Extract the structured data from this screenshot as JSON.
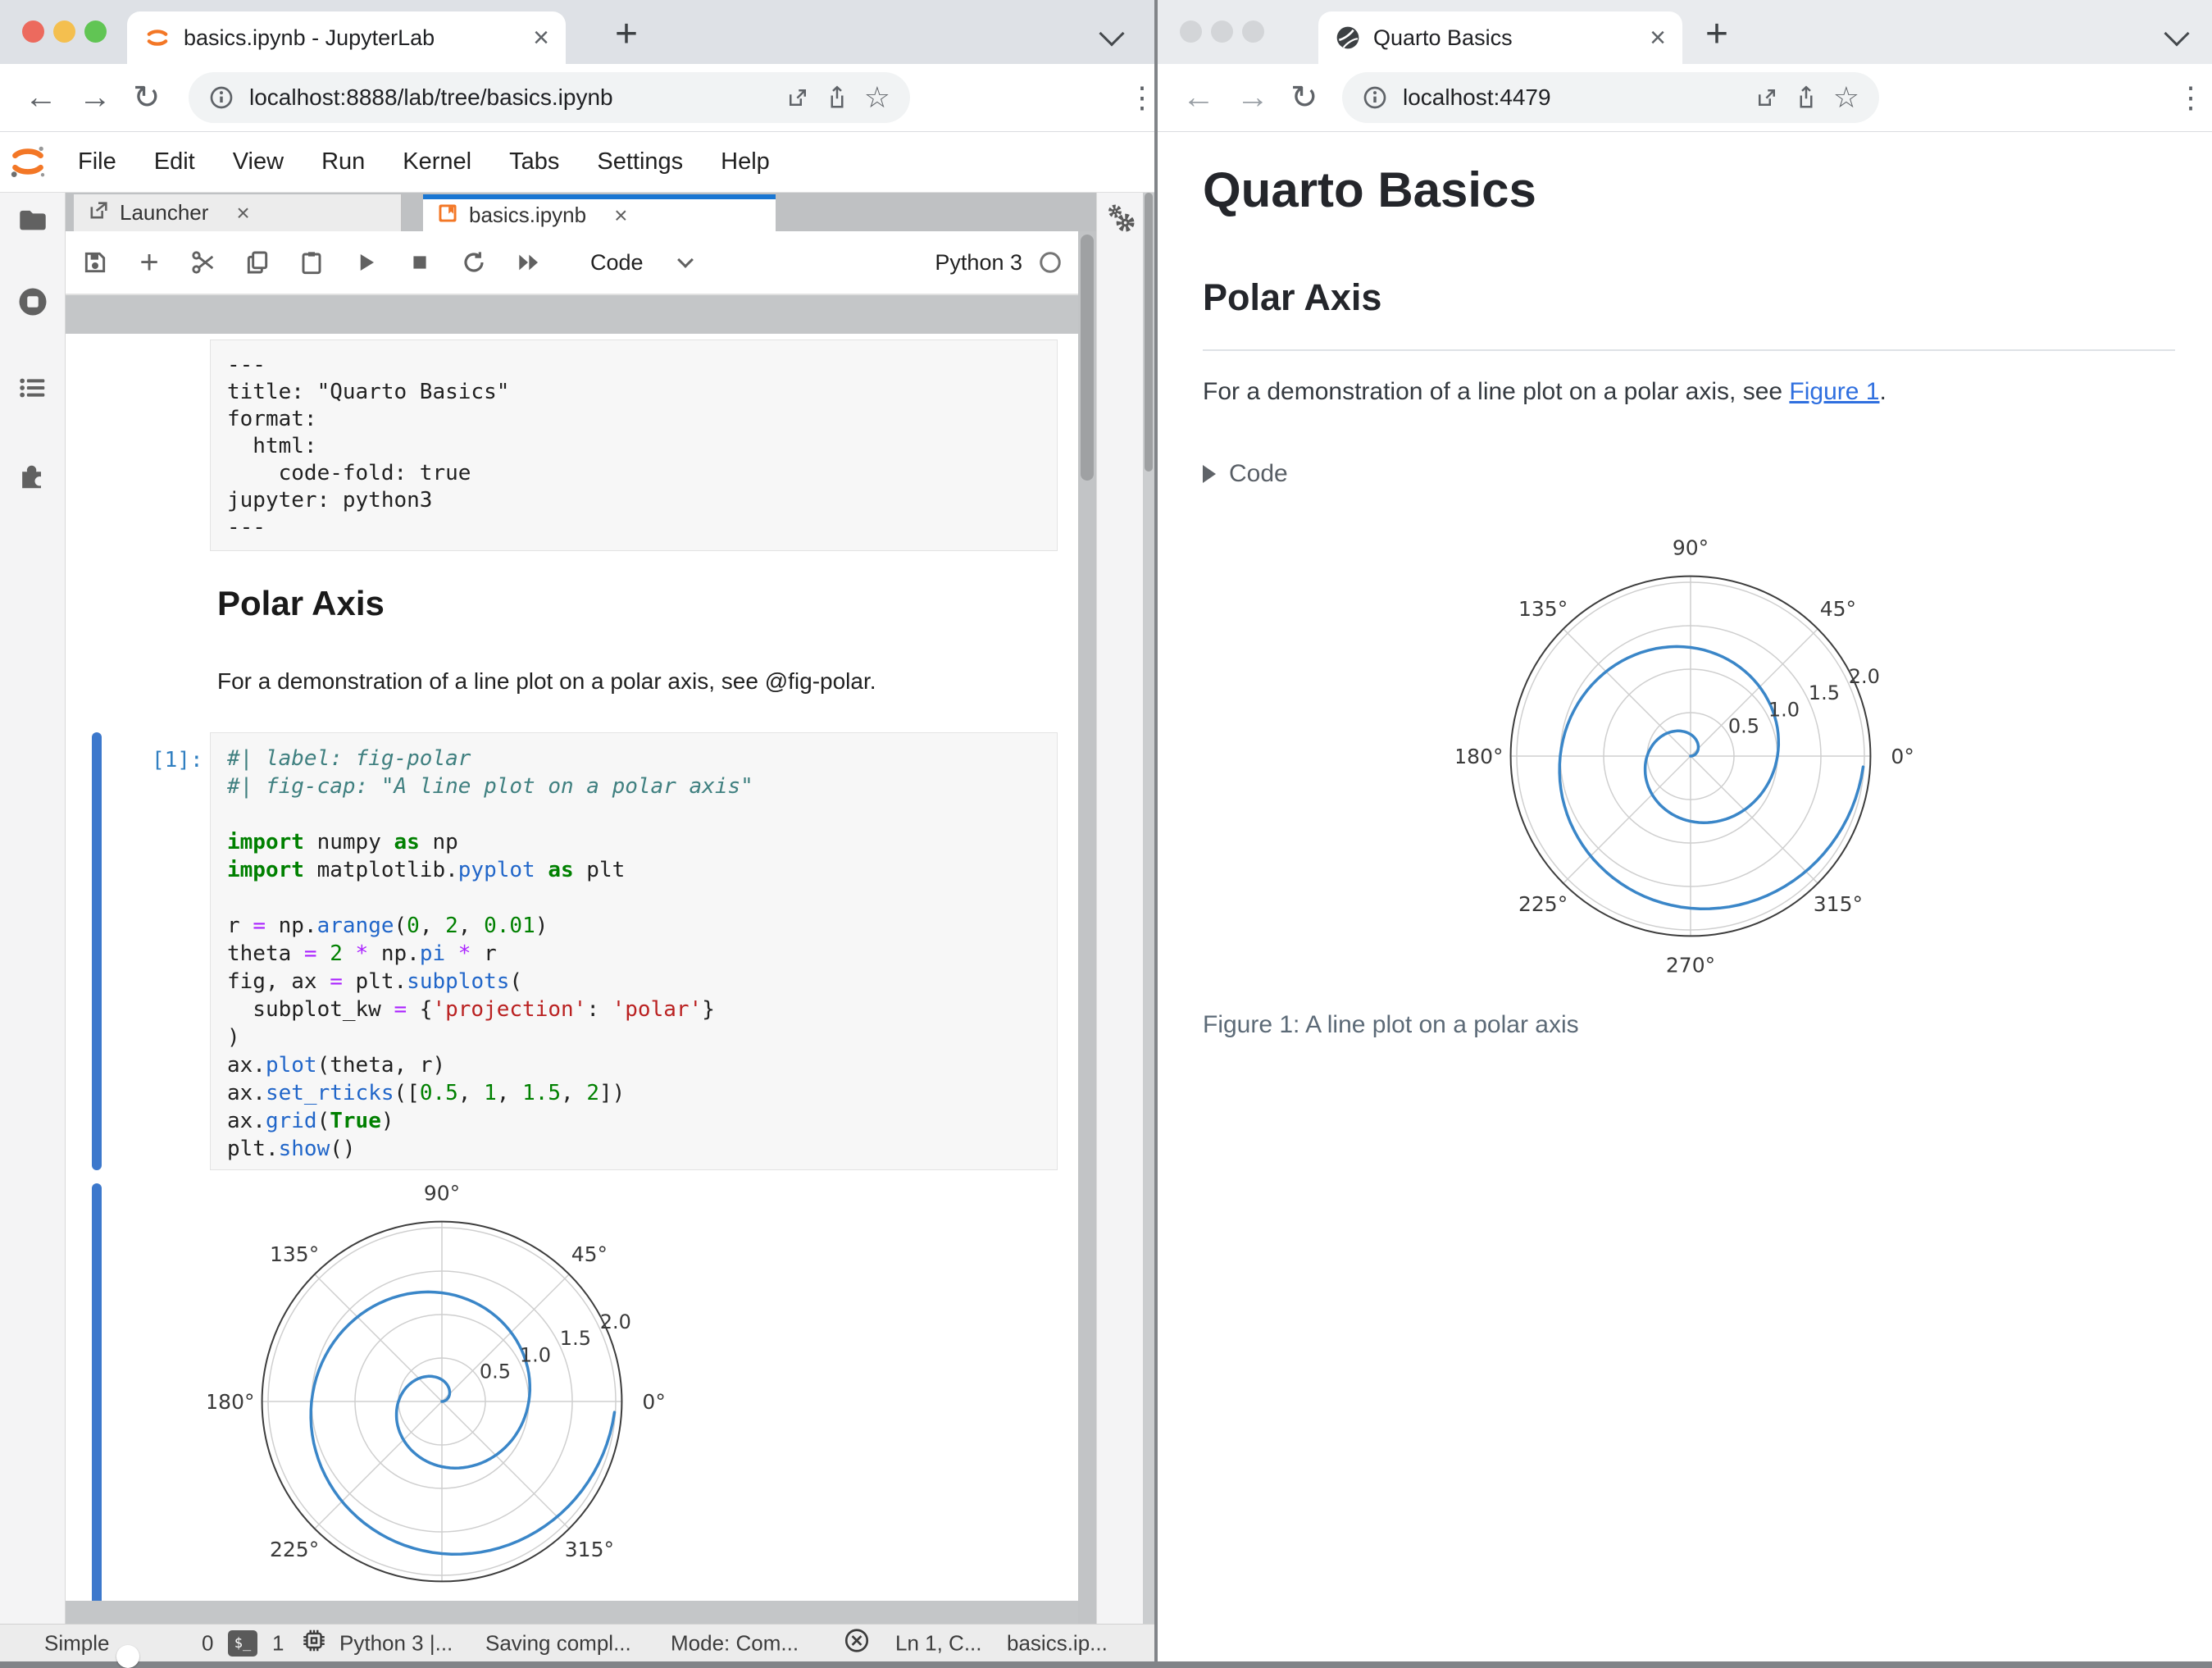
{
  "colors": {
    "jl_accent": "#1976d2",
    "jl_collapser": "#3c78cc",
    "jupyter_orange": "#f37726",
    "link_blue": "#2f6fdf",
    "plot_line_blue": "#3a86c8"
  },
  "chrome_left": {
    "tab_title": "basics.ipynb - JupyterLab",
    "url": "localhost:8888/lab/tree/basics.ipynb"
  },
  "chrome_right": {
    "tab_title": "Quarto Basics",
    "url": "localhost:4479"
  },
  "jupyterlab": {
    "menu": [
      "File",
      "Edit",
      "View",
      "Run",
      "Kernel",
      "Tabs",
      "Settings",
      "Help"
    ],
    "dock_tabs": {
      "launcher": "Launcher",
      "notebook": "basics.ipynb"
    },
    "toolbar": {
      "cell_type": "Code",
      "kernel_name": "Python 3"
    },
    "notebook": {
      "yaml_lines": [
        "---",
        "title: \"Quarto Basics\"",
        "format:",
        "  html:",
        "    code-fold: true",
        "jupyter: python3",
        "---"
      ],
      "md_heading": "Polar Axis",
      "md_paragraph": "For a demonstration of a line plot on a polar axis, see @fig-polar.",
      "prompt": "[1]:",
      "code_lines": [
        [
          [
            "c",
            "#| label: fig-polar"
          ]
        ],
        [
          [
            "c",
            "#| fig-cap: \"A line plot on a polar axis\""
          ]
        ],
        [],
        [
          [
            "k",
            "import"
          ],
          [
            "p",
            " numpy "
          ],
          [
            "k",
            "as"
          ],
          [
            "p",
            " np"
          ]
        ],
        [
          [
            "k",
            "import"
          ],
          [
            "p",
            " matplotlib."
          ],
          [
            "f",
            "pyplot"
          ],
          [
            "p",
            " "
          ],
          [
            "k",
            "as"
          ],
          [
            "p",
            " plt"
          ]
        ],
        [],
        [
          [
            "p",
            "r "
          ],
          [
            "o",
            "="
          ],
          [
            "p",
            " np."
          ],
          [
            "f",
            "arange"
          ],
          [
            "p",
            "("
          ],
          [
            "n",
            "0"
          ],
          [
            "p",
            ", "
          ],
          [
            "n",
            "2"
          ],
          [
            "p",
            ", "
          ],
          [
            "n",
            "0.01"
          ],
          [
            "p",
            ")"
          ]
        ],
        [
          [
            "p",
            "theta "
          ],
          [
            "o",
            "="
          ],
          [
            "p",
            " "
          ],
          [
            "n",
            "2"
          ],
          [
            "p",
            " "
          ],
          [
            "o",
            "*"
          ],
          [
            "p",
            " np."
          ],
          [
            "f",
            "pi"
          ],
          [
            "p",
            " "
          ],
          [
            "o",
            "*"
          ],
          [
            "p",
            " r"
          ]
        ],
        [
          [
            "p",
            "fig, ax "
          ],
          [
            "o",
            "="
          ],
          [
            "p",
            " plt."
          ],
          [
            "f",
            "subplots"
          ],
          [
            "p",
            "("
          ]
        ],
        [
          [
            "p",
            "  subplot_kw "
          ],
          [
            "o",
            "="
          ],
          [
            "p",
            " {"
          ],
          [
            "s",
            "'projection'"
          ],
          [
            "p",
            ": "
          ],
          [
            "s",
            "'polar'"
          ],
          [
            "p",
            "}"
          ]
        ],
        [
          [
            "p",
            ")"
          ]
        ],
        [
          [
            "p",
            "ax."
          ],
          [
            "f",
            "plot"
          ],
          [
            "p",
            "(theta, r)"
          ]
        ],
        [
          [
            "p",
            "ax."
          ],
          [
            "f",
            "set_rticks"
          ],
          [
            "p",
            "(["
          ],
          [
            "n",
            "0.5"
          ],
          [
            "p",
            ", "
          ],
          [
            "n",
            "1"
          ],
          [
            "p",
            ", "
          ],
          [
            "n",
            "1.5"
          ],
          [
            "p",
            ", "
          ],
          [
            "n",
            "2"
          ],
          [
            "p",
            "])"
          ]
        ],
        [
          [
            "p",
            "ax."
          ],
          [
            "f",
            "grid"
          ],
          [
            "p",
            "("
          ],
          [
            "b",
            "True"
          ],
          [
            "p",
            ")"
          ]
        ],
        [
          [
            "p",
            "plt."
          ],
          [
            "f",
            "show"
          ],
          [
            "p",
            "()"
          ]
        ]
      ]
    },
    "statusbar": {
      "simple_label": "Simple",
      "toggle_on": false,
      "terminals_count": "0",
      "kernels_count": "1",
      "kernel_status": "Python 3 |...",
      "saving_status": "Saving compl...",
      "mode": "Mode: Com...",
      "line_col": "Ln 1, C...",
      "filename": "basics.ip..."
    }
  },
  "quarto_page": {
    "title": "Quarto Basics",
    "section_heading": "Polar Axis",
    "paragraph_prefix": "For a demonstration of a line plot on a polar axis, see ",
    "figure_link": "Figure 1",
    "paragraph_suffix": ".",
    "code_toggle_label": "Code",
    "figure_caption": "Figure 1: A line plot on a polar axis"
  },
  "chart_data": {
    "type": "line",
    "projection": "polar",
    "title": "",
    "series": [
      {
        "name": "r = np.arange(0, 2, 0.01); theta = 2*pi*r",
        "r_start": 0,
        "r_end": 1.99,
        "r_step": 0.01,
        "theta_formula_deg": "360 * r",
        "samples_r": [
          0,
          0.2,
          0.4,
          0.6,
          0.8,
          1.0,
          1.2,
          1.4,
          1.6,
          1.8,
          1.99
        ],
        "samples_theta_deg": [
          0,
          72,
          144,
          216,
          288,
          360,
          432,
          504,
          576,
          648,
          716.4
        ]
      }
    ],
    "theta_ticks_deg": [
      0,
      45,
      90,
      135,
      180,
      225,
      270,
      315
    ],
    "theta_tick_labels": [
      "0°",
      "45°",
      "90°",
      "135°",
      "180°",
      "225°",
      "270°",
      "315°"
    ],
    "r_tick_values": [
      0.5,
      1,
      1.5,
      2
    ],
    "r_tick_labels": [
      "0.5",
      "1.0",
      "1.5",
      "2.0"
    ],
    "r_axis_max": 2.07,
    "grid": true,
    "legend": false,
    "line_color": "#3a86c8",
    "grid_color": "#cfcfcf",
    "spine_color": "#3d3d3d",
    "tick_label_color": "#3a3a3a"
  }
}
